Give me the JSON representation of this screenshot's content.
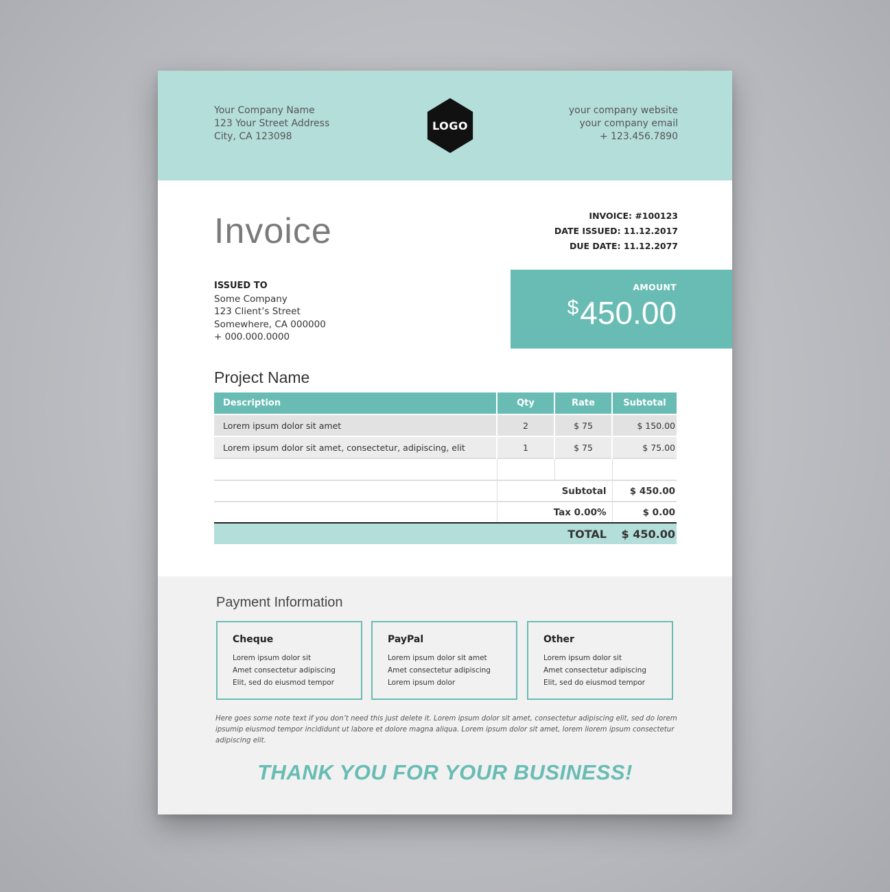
{
  "company": {
    "name": "Your Company Name",
    "address": "123 Your Street Address",
    "city": "City, CA 123098",
    "website": "your company website",
    "email": "your company email",
    "phone": "+ 123.456.7890",
    "logo_text": "LOGO"
  },
  "invoice": {
    "title": "Invoice",
    "number": "INVOICE: #100123",
    "date_issued": "DATE ISSUED: 11.12.2017",
    "due_date": "DUE DATE: 11.12.2077"
  },
  "issued_to": {
    "label": "ISSUED TO",
    "company": "Some Company",
    "street": "123 Client’s Street",
    "city": "Somewhere, CA 000000",
    "phone": "+ 000.000.0000"
  },
  "amount": {
    "label": "AMOUNT",
    "currency": "$",
    "value": "450.00"
  },
  "project_name": "Project Name",
  "table": {
    "headers": [
      "Description",
      "Qty",
      "Rate",
      "Subtotal"
    ],
    "rows": [
      [
        "Lorem ipsum dolor sit amet",
        "2",
        "$ 75",
        "$ 150.00"
      ],
      [
        "Lorem ipsum dolor sit amet, consectetur, adipiscing, elit",
        "1",
        "$ 75",
        "$ 75.00"
      ]
    ],
    "subtotal_label": "Subtotal",
    "subtotal_value": "$ 450.00",
    "tax_label": "Tax 0.00%",
    "tax_value": "$ 0.00",
    "total_label": "TOTAL",
    "total_value": "$ 450.00"
  },
  "payment": {
    "title": "Payment Information",
    "methods": [
      {
        "title": "Cheque",
        "lines": [
          "Lorem ipsum dolor sit",
          "Amet consectetur adipiscing",
          "Elit, sed do eiusmod tempor"
        ]
      },
      {
        "title": "PayPal",
        "lines": [
          "Lorem ipsum dolor sit amet",
          "Amet consectetur adipiscing",
          "Lorem ipsum dolor"
        ]
      },
      {
        "title": "Other",
        "lines": [
          "Lorem ipsum dolor sit",
          "Amet consectetur adipiscing",
          "Elit, sed do eiusmod tempor"
        ]
      }
    ]
  },
  "note": "Here goes some note text if you don’t need this just delete it. Lorem ipsum dolor sit amet, consectetur adipiscing elit, sed do lorem ipsumip eiusmod  tempor incididunt ut labore et dolore magna aliqua. Lorem ipsum dolor sit amet, lorem liorem ipsum consectetur adipiscing elit.",
  "thanks": "THANK YOU FOR YOUR BUSINESS!",
  "colors": {
    "header_bg": "#b4deda",
    "accent": "#68bcb4",
    "footer_bg": "#f1f1f1"
  }
}
